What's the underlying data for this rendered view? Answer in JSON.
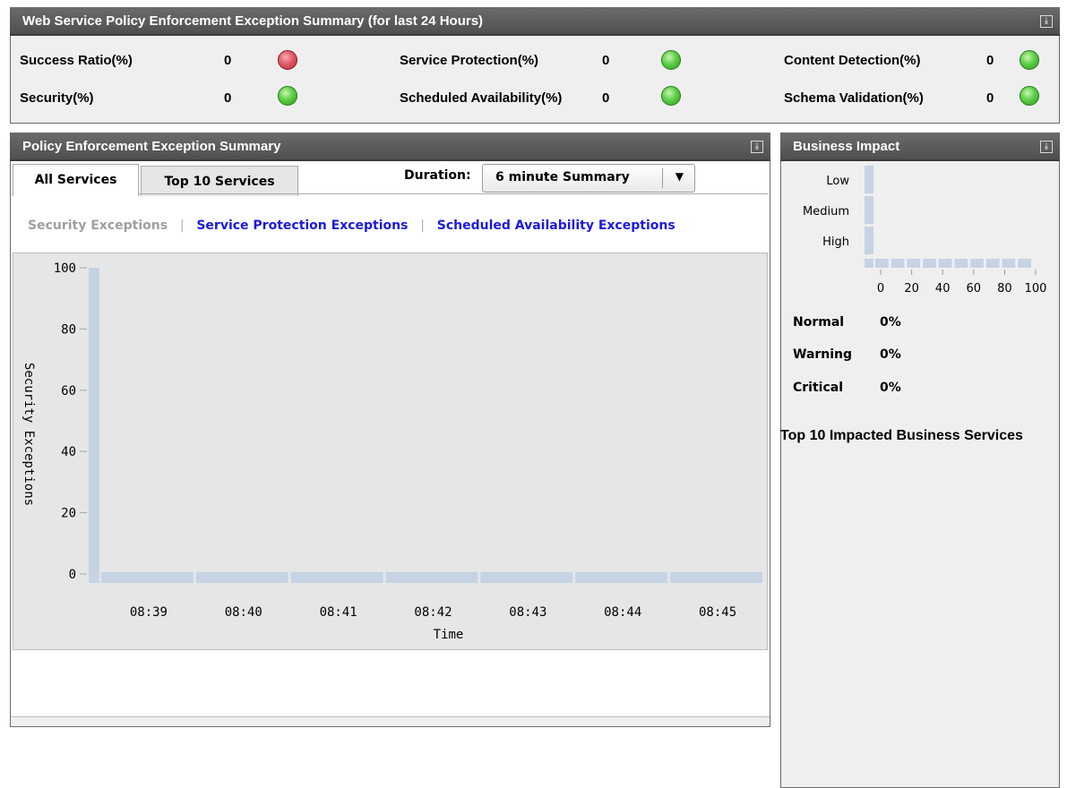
{
  "summary": {
    "title": "Web Service Policy Enforcement Exception Summary (for last 24 Hours)",
    "collapse_icon": "collapse-icon",
    "metrics": [
      {
        "label": "Success Ratio(%)",
        "value": "0",
        "status": "red"
      },
      {
        "label": "Security(%)",
        "value": "0",
        "status": "green"
      },
      {
        "label": "Service Protection(%)",
        "value": "0",
        "status": "green"
      },
      {
        "label": "Scheduled Availability(%)",
        "value": "0",
        "status": "green"
      },
      {
        "label": "Content Detection(%)",
        "value": "0",
        "status": "green"
      },
      {
        "label": "Schema Validation(%)",
        "value": "0",
        "status": "green"
      }
    ]
  },
  "pe": {
    "title": "Policy Enforcement Exception Summary",
    "tabs": [
      "All Services",
      "Top 10 Services"
    ],
    "active_tab": 0,
    "duration_label": "Duration:",
    "duration_value": "6 minute Summary",
    "links": [
      "Security Exceptions",
      "Service Protection Exceptions",
      "Scheduled Availability Exceptions"
    ],
    "active_link": 0
  },
  "bi": {
    "title": "Business Impact",
    "y_categories": [
      "Low",
      "Medium",
      "High"
    ],
    "x_ticks": [
      "0",
      "20",
      "40",
      "60",
      "80",
      "100"
    ],
    "legend": [
      {
        "label": "Normal",
        "value": "0%"
      },
      {
        "label": "Warning",
        "value": "0%"
      },
      {
        "label": "Critical",
        "value": "0%"
      }
    ],
    "top10_title": "Top 10 Impacted Business Services"
  },
  "chart_data": {
    "type": "bar",
    "x": [
      "08:39",
      "08:40",
      "08:41",
      "08:42",
      "08:43",
      "08:44",
      "08:45"
    ],
    "values": [
      0,
      0,
      0,
      0,
      0,
      0,
      0
    ],
    "xlabel": "Time",
    "ylabel": "Security Exceptions",
    "yticks": [
      "100",
      "80",
      "60",
      "40",
      "20",
      "0"
    ],
    "ylim": [
      0,
      100
    ],
    "grid": false
  },
  "colors": {
    "header": "#575757",
    "axis_bar": "#c5d3e3",
    "link": "#1a1ae0",
    "ok": "#4cbf3a",
    "error": "#d9434f"
  }
}
